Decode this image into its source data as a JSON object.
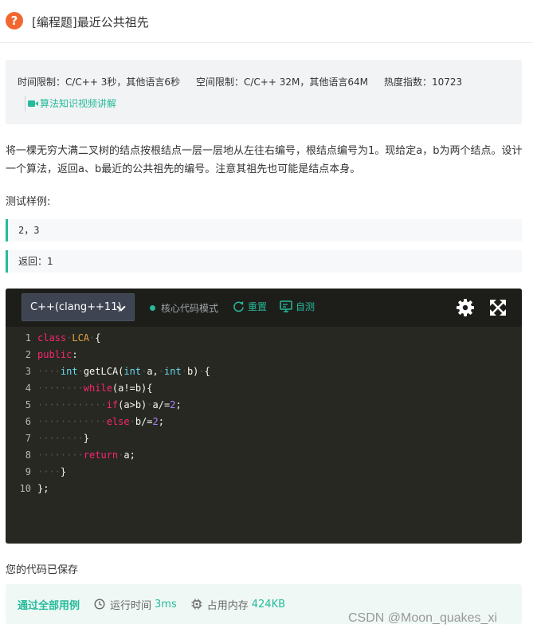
{
  "header": {
    "title": "[编程题]最近公共祖先",
    "icon": "question-icon"
  },
  "limits": {
    "time": "时间限制：C/C++ 3秒，其他语言6秒",
    "space": "空间限制：C/C++ 32M，其他语言64M",
    "heat": "热度指数：10723",
    "video_link": "算法知识视频讲解"
  },
  "description": "将一棵无穷大满二叉树的结点按根结点一层一层地从左往右编号，根结点编号为1。现给定a，b为两个结点。设计一个算法，返回a、b最近的公共祖先的编号。注意其祖先也可能是结点本身。",
  "sample": {
    "label": "测试样例:",
    "input": "2，3",
    "output": "返回：1"
  },
  "editor": {
    "language": "C++(clang++11)",
    "mode": "核心代码模式",
    "reset": "重置",
    "self_test": "自测",
    "line_numbers": [
      "1",
      "2",
      "3",
      "4",
      "5",
      "6",
      "7",
      "8",
      "9",
      "10"
    ]
  },
  "status": {
    "saved": "您的代码已保存",
    "pass": "通过全部用例",
    "runtime_label": "运行时间",
    "runtime_value": "3ms",
    "memory_label": "占用内存",
    "memory_value": "424KB"
  },
  "watermark": "CSDN @Moon_quakes_xi",
  "colors": {
    "accent": "#25bb9b",
    "question_icon": "#f2662f",
    "editor_bg": "#272822"
  }
}
